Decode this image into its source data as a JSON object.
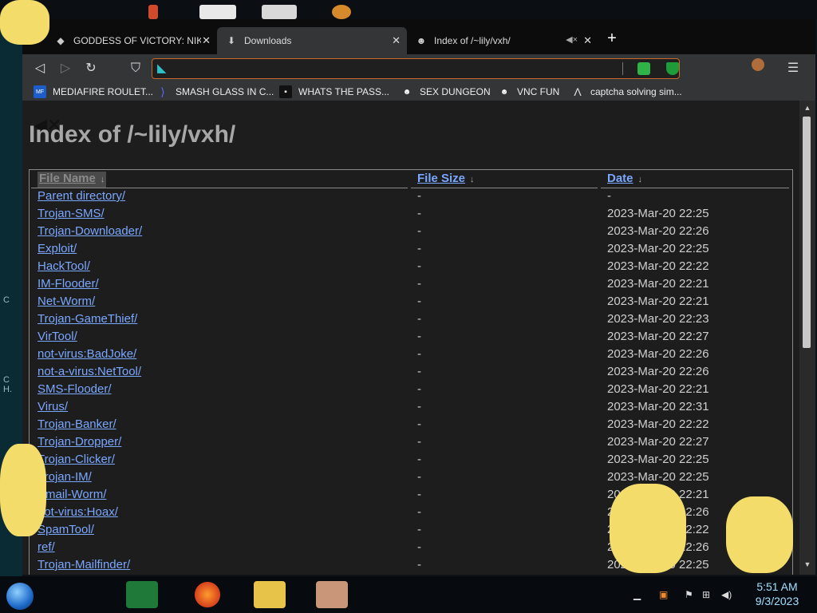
{
  "browser": {
    "tabs": [
      {
        "title": "GODDESS OF VICTORY: NIKKE | Im",
        "active": false
      },
      {
        "title": "Downloads",
        "active": true
      },
      {
        "title": "Index of /~lily/vxh/",
        "active": false
      }
    ],
    "new_tab_label": "+",
    "url": "",
    "bookmarks": [
      {
        "label": "MEDIAFIRE ROULET...",
        "icon": "MF\nT"
      },
      {
        "label": "SMASH GLASS IN C...",
        "icon": "⟩"
      },
      {
        "label": "WHATS THE PASS...",
        "icon": "▪"
      },
      {
        "label": "SEX DUNGEON",
        "icon": "☻"
      },
      {
        "label": "VNC FUN",
        "icon": "☻"
      },
      {
        "label": "captcha solving sim...",
        "icon": "Λ"
      }
    ]
  },
  "page": {
    "title": "Index of /~lily/vxh/",
    "columns": {
      "name": "File Name",
      "size": "File Size",
      "date": "Date",
      "sort_arrow": "↓"
    },
    "rows": [
      {
        "name": "Parent directory/",
        "size": "-",
        "date": "-"
      },
      {
        "name": "Trojan-SMS/",
        "size": "-",
        "date": "2023-Mar-20 22:25"
      },
      {
        "name": "Trojan-Downloader/",
        "size": "-",
        "date": "2023-Mar-20 22:26"
      },
      {
        "name": "Exploit/",
        "size": "-",
        "date": "2023-Mar-20 22:25"
      },
      {
        "name": "HackTool/",
        "size": "-",
        "date": "2023-Mar-20 22:22"
      },
      {
        "name": "IM-Flooder/",
        "size": "-",
        "date": "2023-Mar-20 22:21"
      },
      {
        "name": "Net-Worm/",
        "size": "-",
        "date": "2023-Mar-20 22:21"
      },
      {
        "name": "Trojan-GameThief/",
        "size": "-",
        "date": "2023-Mar-20 22:23"
      },
      {
        "name": "VirTool/",
        "size": "-",
        "date": "2023-Mar-20 22:27"
      },
      {
        "name": "not-virus:BadJoke/",
        "size": "-",
        "date": "2023-Mar-20 22:26"
      },
      {
        "name": "not-a-virus:NetTool/",
        "size": "-",
        "date": "2023-Mar-20 22:26"
      },
      {
        "name": "SMS-Flooder/",
        "size": "-",
        "date": "2023-Mar-20 22:21"
      },
      {
        "name": "Virus/",
        "size": "-",
        "date": "2023-Mar-20 22:31"
      },
      {
        "name": "Trojan-Banker/",
        "size": "-",
        "date": "2023-Mar-20 22:22"
      },
      {
        "name": "Trojan-Dropper/",
        "size": "-",
        "date": "2023-Mar-20 22:27"
      },
      {
        "name": "Trojan-Clicker/",
        "size": "-",
        "date": "2023-Mar-20 22:25"
      },
      {
        "name": "Trojan-IM/",
        "size": "-",
        "date": "2023-Mar-20 22:25"
      },
      {
        "name": "Email-Worm/",
        "size": "-",
        "date": "2023-Mar-20 22:21"
      },
      {
        "name": "not-virus:Hoax/",
        "size": "-",
        "date": "2023-Mar-20 22:26"
      },
      {
        "name": "SpamTool/",
        "size": "-",
        "date": "2023-Mar-20 22:22"
      },
      {
        "name": "ref/",
        "size": "-",
        "date": "2023-Mar-20 22:26"
      },
      {
        "name": "Trojan-Mailfinder/",
        "size": "-",
        "date": "2023-Mar-20 22:25"
      }
    ]
  },
  "taskbar": {
    "time": "5:51 AM",
    "date": "9/3/2023"
  },
  "colors": {
    "link": "#7aa7ff",
    "url_border": "#c96a2a",
    "accent_teal": "#0fb5c9"
  }
}
